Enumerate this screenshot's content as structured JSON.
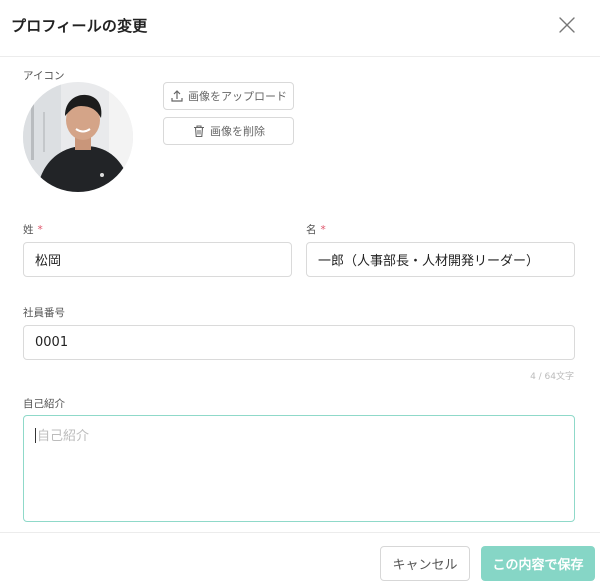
{
  "header": {
    "title": "プロフィールの変更"
  },
  "icon_section": {
    "label": "アイコン",
    "upload_label": "画像をアップロード",
    "delete_label": "画像を削除"
  },
  "last_name": {
    "label": "姓",
    "required_mark": "*",
    "value": "松岡"
  },
  "first_name": {
    "label": "名",
    "required_mark": "*",
    "value": "一郎（人事部長・人材開発リーダー）"
  },
  "employee_number": {
    "label": "社員番号",
    "value": "0001",
    "counter": "4 / 64文字"
  },
  "bio": {
    "label": "自己紹介",
    "placeholder": "自己紹介",
    "value": ""
  },
  "footer": {
    "cancel_label": "キャンセル",
    "save_label": "この内容で保存"
  },
  "colors": {
    "accent": "#86d6c6",
    "focus_border": "#8fd9c9",
    "required": "#e0556b"
  }
}
